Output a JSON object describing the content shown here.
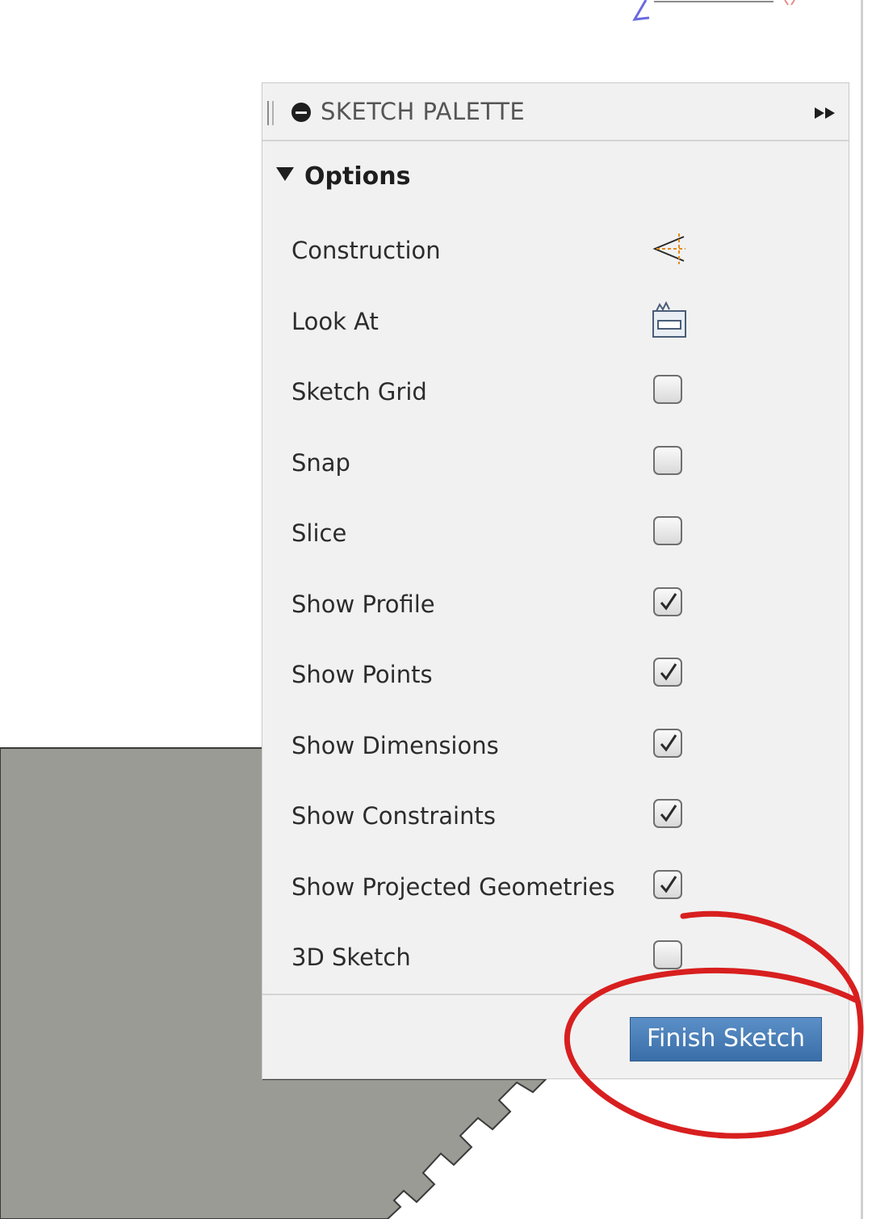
{
  "palette": {
    "title": "SKETCH PALETTE",
    "section_label": "Options",
    "options": [
      {
        "label": "Construction",
        "control": "construction-icon"
      },
      {
        "label": "Look At",
        "control": "look-at-icon"
      },
      {
        "label": "Sketch Grid",
        "control": "checkbox",
        "checked": false
      },
      {
        "label": "Snap",
        "control": "checkbox",
        "checked": false
      },
      {
        "label": "Slice",
        "control": "checkbox",
        "checked": false
      },
      {
        "label": "Show Profile",
        "control": "checkbox",
        "checked": true
      },
      {
        "label": "Show Points",
        "control": "checkbox",
        "checked": true
      },
      {
        "label": "Show Dimensions",
        "control": "checkbox",
        "checked": true
      },
      {
        "label": "Show Constraints",
        "control": "checkbox",
        "checked": true
      },
      {
        "label": "Show Projected Geometries",
        "control": "checkbox",
        "checked": true
      },
      {
        "label": "3D Sketch",
        "control": "checkbox",
        "checked": false
      }
    ],
    "finish_button": "Finish Sketch"
  },
  "colors": {
    "panel_bg": "#f1f1f1",
    "button_blue": "#4a7fb8",
    "model_gray": "#999b94",
    "annotation_red": "#d81f1f",
    "construction_orange": "#e8891c"
  }
}
